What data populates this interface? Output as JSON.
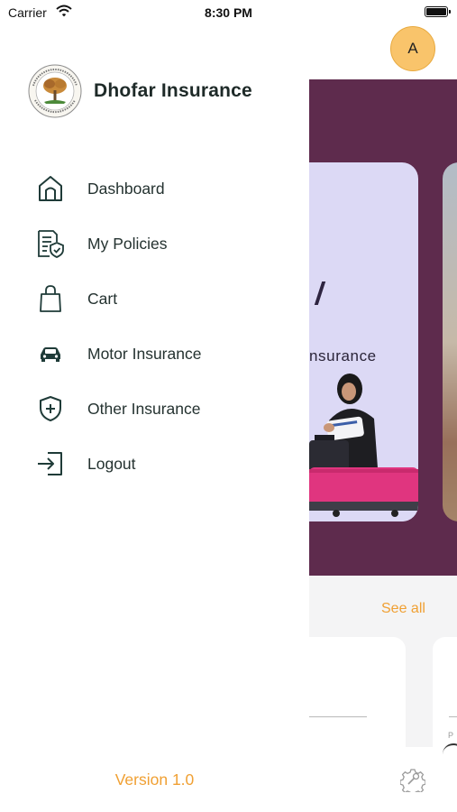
{
  "status_bar": {
    "carrier": "Carrier",
    "time": "8:30 PM"
  },
  "drawer": {
    "brand": {
      "name": "Dhofar Insurance"
    },
    "menu": [
      {
        "label": "Dashboard",
        "icon": "home-icon"
      },
      {
        "label": "My Policies",
        "icon": "policy-document-icon"
      },
      {
        "label": "Cart",
        "icon": "shopping-bag-icon"
      },
      {
        "label": "Motor Insurance",
        "icon": "car-icon"
      },
      {
        "label": "Other Insurance",
        "icon": "shield-plus-icon"
      },
      {
        "label": "Logout",
        "icon": "logout-icon"
      }
    ],
    "version": "Version 1.0"
  },
  "background": {
    "avatar_initial": "A",
    "banner_text": "nsurance",
    "see_all": "See all",
    "mini_label": "P"
  },
  "colors": {
    "accent_orange": "#f0a033",
    "banner_purple": "#5e2b4d",
    "avatar_yellow": "#f9c46b",
    "icon_dark_green": "#1f3b38"
  }
}
